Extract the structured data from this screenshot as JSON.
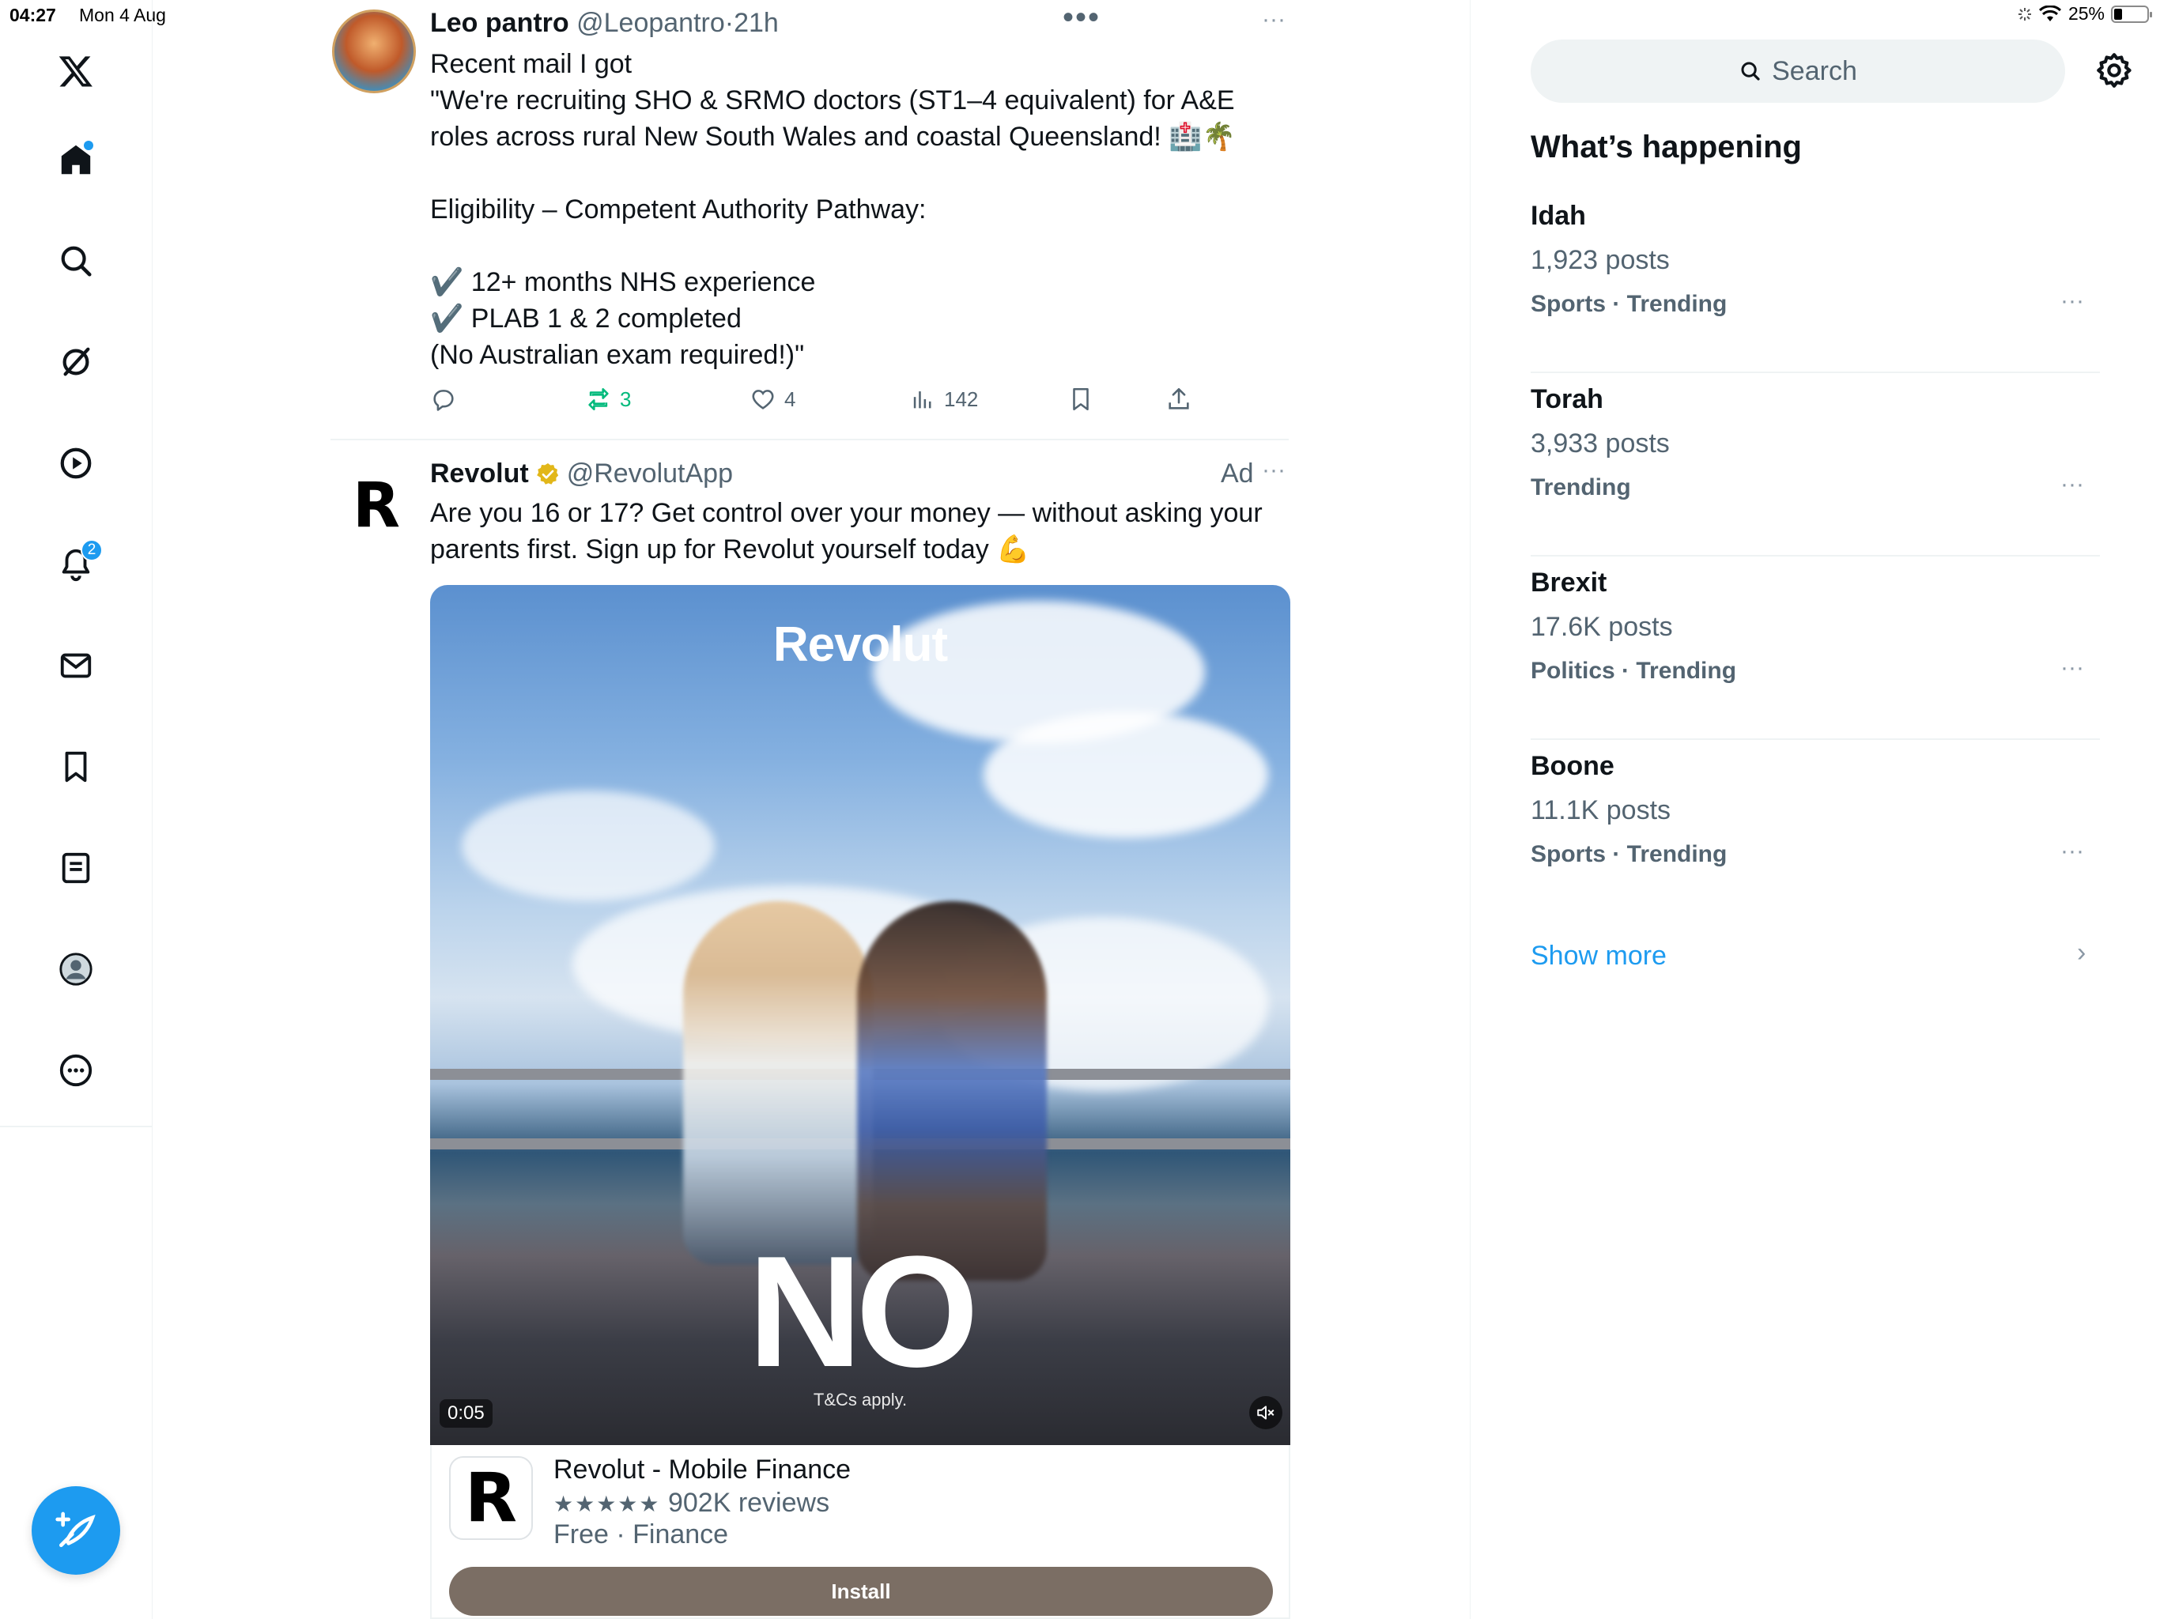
{
  "status_bar": {
    "time": "04:27",
    "date": "Mon 4 Aug",
    "battery": "25%",
    "battery_level": 0.25
  },
  "nav": {
    "notifications_badge": "2",
    "icons": [
      "x-logo-icon",
      "home-icon",
      "search-icon",
      "grok-icon",
      "video-icon",
      "notifications-icon",
      "messages-icon",
      "bookmarks-icon",
      "lists-icon",
      "profile-icon",
      "more-icon"
    ]
  },
  "tweet1": {
    "name": "Leo pantro",
    "handle": "@Leopantro",
    "time": "21h",
    "more": "···",
    "body": "Recent mail I got\n\"We're recruiting SHO & SRMO doctors (ST1–4 equivalent) for A&E roles across rural New South Wales and coastal Queensland! 🏥🌴\n\nEligibility – Competent Authority Pathway:\n\n✔️ 12+ months NHS experience\n✔️ PLAB 1 & 2 completed\n(No Australian exam required!)\"",
    "retweets": "3",
    "likes": "4",
    "views": "142"
  },
  "feed_top_dots": "•••",
  "tweet2": {
    "name": "Revolut",
    "handle": "@RevolutApp",
    "ad": "Ad",
    "more": "···",
    "logo": "R",
    "body": "Are you 16 or 17? Get control over your money — without asking your parents first. Sign up for Revolut yourself today 💪",
    "media": {
      "brand": "Revolut",
      "overlay": "NO",
      "terms": "T&Cs apply.",
      "duration": "0:05"
    },
    "app": {
      "icon": "R",
      "name": "Revolut - Mobile Finance",
      "stars": "★★★★★",
      "reviews": "902K reviews",
      "meta": "Free · Finance",
      "install": "Install"
    }
  },
  "right": {
    "search_placeholder": "Search",
    "section_title": "What’s happening",
    "trends": [
      {
        "name": "Idah",
        "posts": "1,923 posts",
        "category": "Sports · Trending"
      },
      {
        "name": "Torah",
        "posts": "3,933 posts",
        "category": "Trending"
      },
      {
        "name": "Brexit",
        "posts": "17.6K posts",
        "category": "Politics · Trending"
      },
      {
        "name": "Boone",
        "posts": "11.1K posts",
        "category": "Sports · Trending"
      }
    ],
    "trend_more": "···",
    "show_more": "Show more",
    "show_more_chevron": "›"
  }
}
